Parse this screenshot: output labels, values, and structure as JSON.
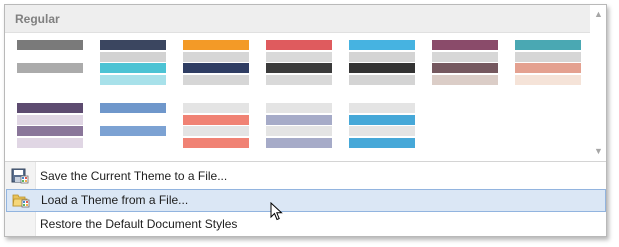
{
  "gallery": {
    "group_title": "Regular",
    "themes": [
      {
        "name": "theme-gray",
        "bars": [
          "#7a7a7a",
          "#ffffff",
          "#ababab",
          "#ffffff"
        ]
      },
      {
        "name": "theme-slate",
        "bars": [
          "#3b4660",
          "#d2d2d2",
          "#4cc3d4",
          "#a8e1ea"
        ]
      },
      {
        "name": "theme-orange",
        "bars": [
          "#f39a27",
          "#d6d6d6",
          "#2f3d63",
          "#d6d6d6"
        ]
      },
      {
        "name": "theme-red",
        "bars": [
          "#df5b5e",
          "#d9d9d9",
          "#3b3b3b",
          "#d9d9d9"
        ]
      },
      {
        "name": "theme-blue-dark",
        "bars": [
          "#46b3e1",
          "#d4d4d4",
          "#333333",
          "#d4d4d4"
        ]
      },
      {
        "name": "theme-plum",
        "bars": [
          "#8a4b6a",
          "#d7d7d7",
          "#75585f",
          "#dbcdc7"
        ]
      },
      {
        "name": "theme-teal",
        "bars": [
          "#4aa8b3",
          "#d6d6d6",
          "#e4a190",
          "#f5e3d8"
        ]
      },
      {
        "name": "theme-purple",
        "bars": [
          "#5d4b70",
          "#e0d6e4",
          "#8a769a",
          "#e0d6e4"
        ]
      },
      {
        "name": "theme-cornflower",
        "bars": [
          "#6f97cb",
          "#ffffff",
          "#7ca2d3",
          "#ffffff"
        ]
      },
      {
        "name": "theme-salmon",
        "bars": [
          "#e4e4e4",
          "#f08274",
          "#e4e4e4",
          "#f08274"
        ]
      },
      {
        "name": "theme-lavender",
        "bars": [
          "#e4e4e4",
          "#a6abc8",
          "#e4e4e4",
          "#a6abc8"
        ]
      },
      {
        "name": "theme-sky",
        "bars": [
          "#e4e4e4",
          "#46a8d8",
          "#e4e4e4",
          "#46a8d8"
        ]
      }
    ]
  },
  "menu": {
    "items": [
      {
        "label": "Save the Current Theme to a File...",
        "icon": "save-theme-icon"
      },
      {
        "label": "Load a Theme from a File...",
        "icon": "open-folder-icon"
      },
      {
        "label": "Restore the Default Document Styles",
        "icon": ""
      }
    ]
  },
  "colors": {
    "selection_bg": "#dbe7f5",
    "selection_border": "#92b4df",
    "header_bg": "#eeeeee"
  }
}
